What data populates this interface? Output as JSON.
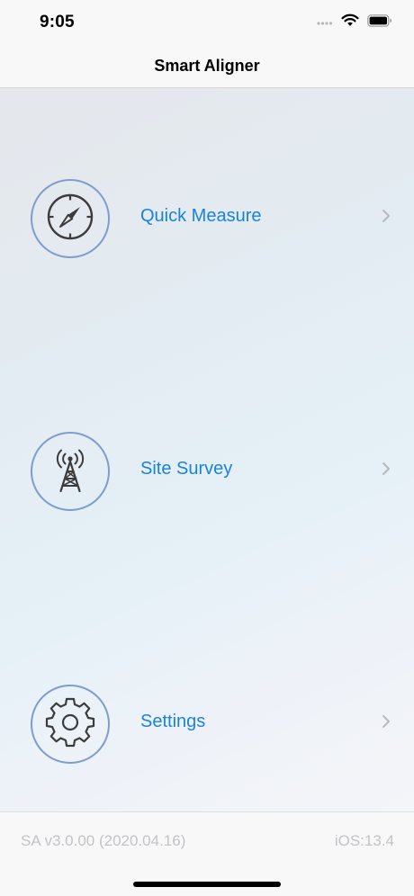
{
  "status_bar": {
    "time": "9:05"
  },
  "nav": {
    "title": "Smart Aligner"
  },
  "menu": [
    {
      "label": "Quick Measure",
      "icon": "compass-icon"
    },
    {
      "label": "Site Survey",
      "icon": "radio-tower-icon"
    },
    {
      "label": "Settings",
      "icon": "gear-icon"
    }
  ],
  "footer": {
    "version": "SA v3.0.00 (2020.04.16)",
    "ios": "iOS:13.4"
  },
  "colors": {
    "accent": "#1a83d8",
    "icon_ring": "#7e9ccc",
    "icon_stroke": "#3c3c3c",
    "footer_text": "#c3c3c7"
  }
}
